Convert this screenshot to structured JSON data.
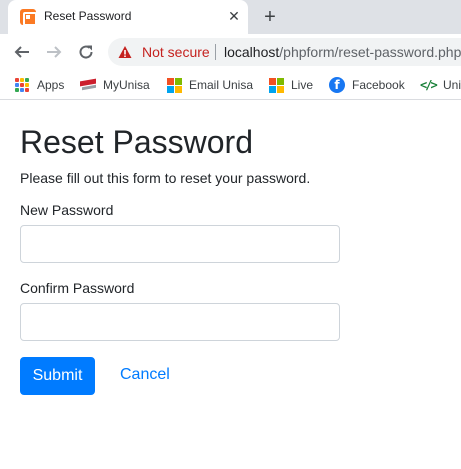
{
  "tab": {
    "title": "Reset Password",
    "close_glyph": "✕",
    "new_tab_glyph": "+"
  },
  "toolbar": {
    "security_label": "Not secure",
    "url_host": "localhost",
    "url_path": "/phpform/reset-password.php"
  },
  "bookmarks": [
    {
      "label": "Apps",
      "icon": "apps-grid-icon"
    },
    {
      "label": "MyUnisa",
      "icon": "unisa-icon"
    },
    {
      "label": "Email Unisa",
      "icon": "microsoft-icon"
    },
    {
      "label": "Live",
      "icon": "microsoft-icon"
    },
    {
      "label": "Facebook",
      "icon": "facebook-icon",
      "glyph": "f"
    },
    {
      "label": "Uni",
      "icon": "code-icon",
      "glyph": "</>"
    }
  ],
  "form": {
    "title": "Reset Password",
    "intro": "Please fill out this form to reset your password.",
    "new_password_label": "New Password",
    "new_password_value": "",
    "confirm_password_label": "Confirm Password",
    "confirm_password_value": "",
    "submit_label": "Submit",
    "cancel_label": "Cancel"
  },
  "colors": {
    "primary": "#007bff",
    "warning": "#c5221f",
    "tab_strip": "#dee1e6",
    "text": "#212529",
    "input_border": "#ced4da",
    "xampp_orange": "#fb7a24"
  }
}
